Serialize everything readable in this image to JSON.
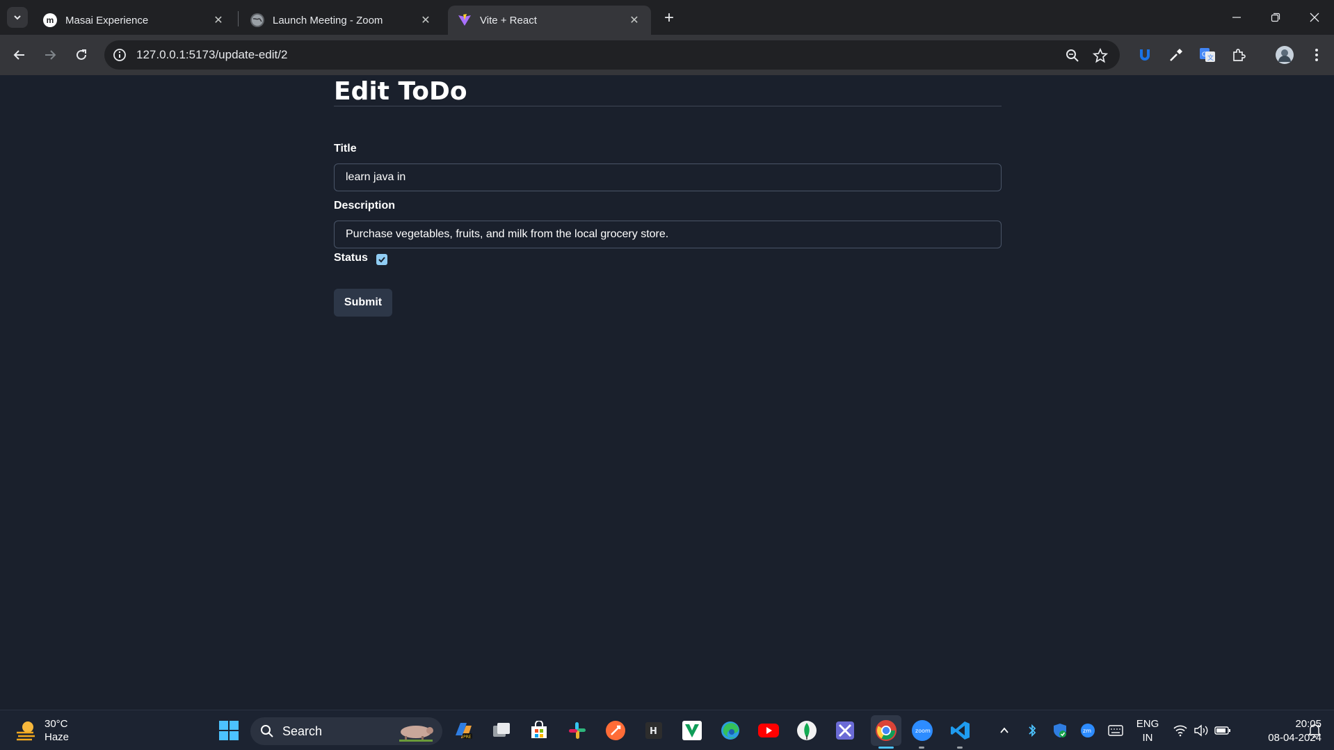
{
  "browser": {
    "tabs": [
      {
        "label": "Masai Experience",
        "icon": "masai-m-icon",
        "active": false
      },
      {
        "label": "Launch Meeting - Zoom",
        "icon": "globe-icon",
        "active": false
      },
      {
        "label": "Vite + React",
        "icon": "vite-logo-icon",
        "active": true
      }
    ],
    "url": "127.0.0.1:5173/update-edit/2"
  },
  "page": {
    "heading": "Edit ToDo",
    "title_label": "Title",
    "title_value": "learn java in",
    "description_label": "Description",
    "description_value": "Purchase vegetables, fruits, and milk from the local grocery store.",
    "status_label": "Status",
    "status_checked": true,
    "submit_label": "Submit"
  },
  "taskbar": {
    "weather_temp": "30°C",
    "weather_desc": "Haze",
    "search_label": "Search",
    "language_line1": "ENG",
    "language_line2": "IN",
    "time": "20:05",
    "date": "08-04-2024"
  },
  "colors": {
    "page_bg": "#1a202c",
    "checkbox": "#90cdf4",
    "button_bg": "#2d3748",
    "chrome_dark": "#202124",
    "chrome_toolbar": "#35363a"
  }
}
